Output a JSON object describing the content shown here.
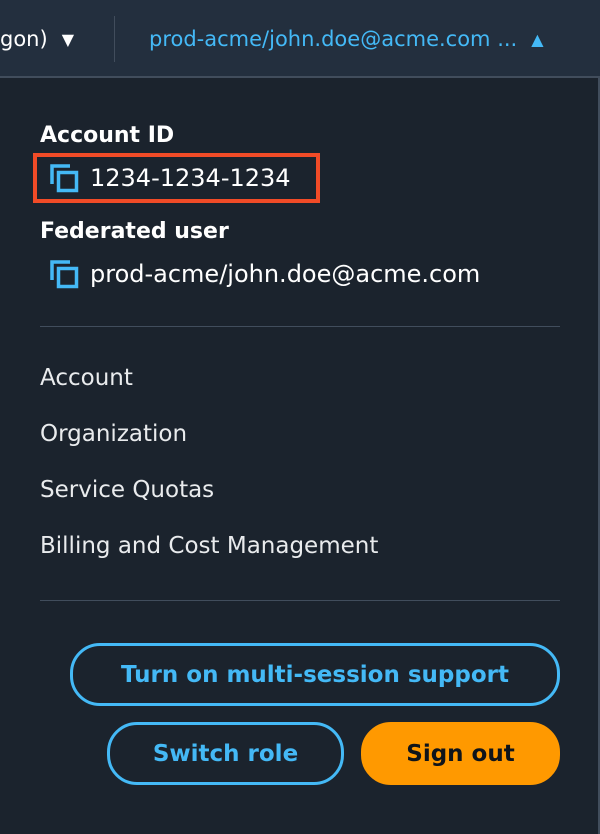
{
  "header": {
    "region_label": "gon)",
    "account_label": "prod-acme/john.doe@acme.com ...",
    "region_caret": "▼",
    "account_caret": "▲"
  },
  "account": {
    "account_id_label": "Account ID",
    "account_id_value": "1234-1234-1234",
    "federated_user_label": "Federated user",
    "federated_user_value": "prod-acme/john.doe@acme.com"
  },
  "menu": {
    "items": [
      {
        "label": "Account"
      },
      {
        "label": "Organization"
      },
      {
        "label": "Service Quotas"
      },
      {
        "label": "Billing and Cost Management"
      }
    ]
  },
  "actions": {
    "multi_session_label": "Turn on multi-session support",
    "switch_role_label": "Switch role",
    "sign_out_label": "Sign out"
  },
  "colors": {
    "accent_link": "#44b9f6",
    "primary_button": "#ff9900",
    "highlight_border": "#f14b27",
    "panel_background": "#1b232d"
  },
  "icons": {
    "copy": "copy-icon",
    "caret_down": "caret-down-icon",
    "caret_up": "caret-up-icon"
  }
}
